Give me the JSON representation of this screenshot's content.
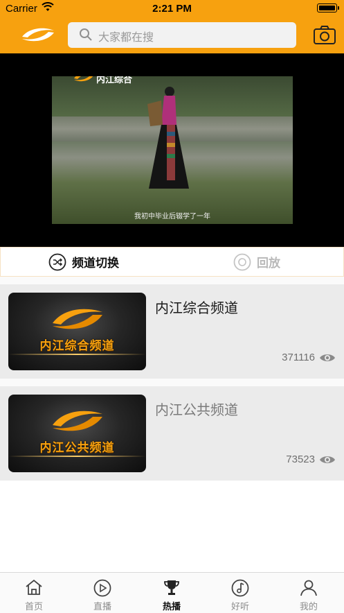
{
  "status_bar": {
    "carrier": "Carrier",
    "time": "2:21 PM"
  },
  "header": {
    "search_placeholder": "大家都在搜"
  },
  "video": {
    "watermark": "内江综合",
    "subtitle": "我初中毕业后辍学了一年"
  },
  "tabs": [
    {
      "label": "频道切换",
      "active": true
    },
    {
      "label": "回放",
      "active": false
    }
  ],
  "channels": [
    {
      "name": "内江综合频道",
      "thumb_text": "内江综合频道",
      "views": "371116"
    },
    {
      "name": "内江公共频道",
      "thumb_text": "内江公共频道",
      "views": "73523"
    }
  ],
  "tabbar": [
    {
      "label": "首页",
      "icon": "home-icon",
      "active": false
    },
    {
      "label": "直播",
      "icon": "play-icon",
      "active": false
    },
    {
      "label": "热播",
      "icon": "trophy-icon",
      "active": true
    },
    {
      "label": "好听",
      "icon": "music-icon",
      "active": false
    },
    {
      "label": "我的",
      "icon": "user-icon",
      "active": false
    }
  ],
  "colors": {
    "brand_orange": "#f7a10f",
    "card_bg": "#ebebeb"
  }
}
